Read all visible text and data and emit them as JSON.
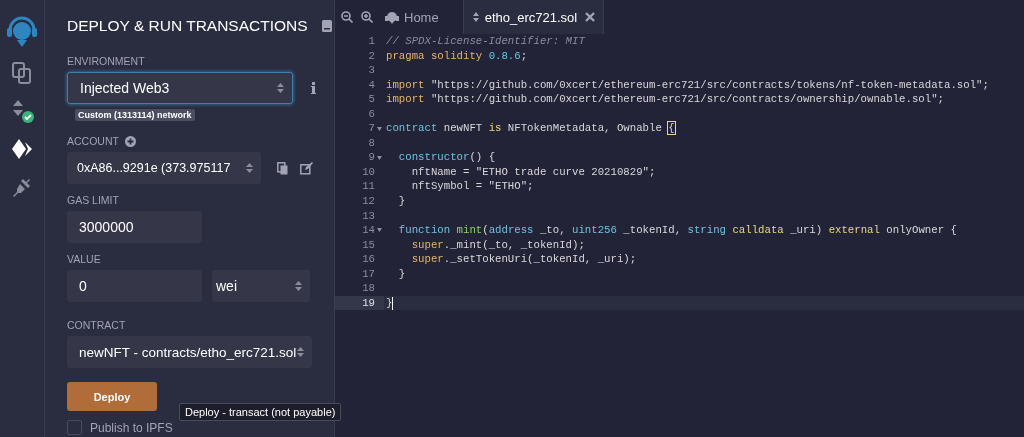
{
  "icon_bar": [
    {
      "kind": "files",
      "selected": false
    },
    {
      "kind": "compiler",
      "selected": false
    },
    {
      "kind": "deploy",
      "selected": true
    },
    {
      "kind": "plugins",
      "selected": false
    }
  ],
  "panel": {
    "title": "DEPLOY & RUN TRANSACTIONS",
    "environment": {
      "label": "ENVIRONMENT",
      "value": "Injected Web3",
      "network": "Custom (1313114) network"
    },
    "account": {
      "label": "ACCOUNT",
      "value": "0xA86...9291e (373.975117"
    },
    "gas_limit": {
      "label": "GAS LIMIT",
      "value": "3000000"
    },
    "value": {
      "label": "VALUE",
      "amount": "0",
      "unit": "wei"
    },
    "contract": {
      "label": "CONTRACT",
      "value": "newNFT - contracts/etho_erc721.sol"
    },
    "deploy_button": "Deploy",
    "tooltip": "Deploy - transact (not payable)",
    "publish": {
      "label": "Publish to IPFS",
      "checked": false
    }
  },
  "editor": {
    "tabs": [
      {
        "kind": "home",
        "label": "Home",
        "selected": false
      },
      {
        "kind": "file",
        "label": "etho_erc721.sol",
        "selected": true
      }
    ],
    "lines": [
      {
        "number": "1",
        "fold": false,
        "active": false,
        "tokens": [
          {
            "kind": "comment",
            "text": "// SPDX-License-Identifier: MIT"
          }
        ]
      },
      {
        "number": "2",
        "fold": false,
        "active": false,
        "tokens": [
          {
            "kind": "keyword",
            "text": "pragma solidity "
          },
          {
            "kind": "number",
            "text": "0.8.6"
          },
          {
            "kind": "plain",
            "text": ";"
          }
        ]
      },
      {
        "number": "3",
        "fold": false,
        "active": false
      },
      {
        "number": "4",
        "fold": false,
        "active": false,
        "tokens": [
          {
            "kind": "keyword",
            "text": "import "
          },
          {
            "kind": "plain",
            "text": "\"https://github.com/0xcert/ethereum-erc721/src/contracts/tokens/nf-token-metadata.sol\";"
          }
        ]
      },
      {
        "number": "5",
        "fold": false,
        "active": false,
        "tokens": [
          {
            "kind": "keyword",
            "text": "import "
          },
          {
            "kind": "plain",
            "text": "\"https://github.com/0xcert/ethereum-erc721/src/contracts/ownership/ownable.sol\";"
          }
        ]
      },
      {
        "number": "6",
        "fold": false,
        "active": false
      },
      {
        "number": "7",
        "fold": true,
        "active": false,
        "tokens": [
          {
            "kind": "type",
            "text": "contract"
          },
          {
            "kind": "plain",
            "text": " newNFT "
          },
          {
            "kind": "modifier",
            "text": "is"
          },
          {
            "kind": "plain",
            "text": " NFTokenMetadata, Ownable "
          },
          {
            "kind": "bracket",
            "text": "{"
          }
        ]
      },
      {
        "number": "8",
        "fold": false,
        "active": false
      },
      {
        "number": "9",
        "fold": true,
        "active": false,
        "tokens": [
          {
            "kind": "type",
            "text": "  constructor"
          },
          {
            "kind": "plain",
            "text": "() {"
          }
        ]
      },
      {
        "number": "10",
        "fold": false,
        "active": false,
        "tokens": [
          {
            "kind": "plain",
            "text": "    nftName = \"ETHO trade curve 20210829\";"
          }
        ]
      },
      {
        "number": "11",
        "fold": false,
        "active": false,
        "tokens": [
          {
            "kind": "plain",
            "text": "    nftSymbol = \"ETHO\";"
          }
        ]
      },
      {
        "number": "12",
        "fold": false,
        "active": false,
        "tokens": [
          {
            "kind": "plain",
            "text": "  }"
          }
        ]
      },
      {
        "number": "13",
        "fold": false,
        "active": false
      },
      {
        "number": "14",
        "fold": true,
        "active": false,
        "tokens": [
          {
            "kind": "type",
            "text": "  function "
          },
          {
            "kind": "func",
            "text": "mint"
          },
          {
            "kind": "plain",
            "text": "("
          },
          {
            "kind": "type",
            "text": "address"
          },
          {
            "kind": "plain",
            "text": " _to, "
          },
          {
            "kind": "type",
            "text": "uint256"
          },
          {
            "kind": "plain",
            "text": " _tokenId, "
          },
          {
            "kind": "type",
            "text": "string "
          },
          {
            "kind": "modifier",
            "text": "calldata"
          },
          {
            "kind": "plain",
            "text": " _uri) "
          },
          {
            "kind": "modifier",
            "text": "external"
          },
          {
            "kind": "plain",
            "text": " onlyOwner {"
          }
        ]
      },
      {
        "number": "15",
        "fold": false,
        "active": false,
        "tokens": [
          {
            "kind": "keyword",
            "text": "    super"
          },
          {
            "kind": "plain",
            "text": "._mint(_to, _tokenId);"
          }
        ]
      },
      {
        "number": "16",
        "fold": false,
        "active": false,
        "tokens": [
          {
            "kind": "keyword",
            "text": "    super"
          },
          {
            "kind": "plain",
            "text": "._setTokenUri(_tokenId, _uri);"
          }
        ]
      },
      {
        "number": "17",
        "fold": false,
        "active": false,
        "tokens": [
          {
            "kind": "plain",
            "text": "  }"
          }
        ]
      },
      {
        "number": "18",
        "fold": false,
        "active": false
      },
      {
        "number": "19",
        "fold": false,
        "active": true,
        "tokens": [
          {
            "kind": "plain",
            "text": "}"
          }
        ]
      }
    ]
  }
}
